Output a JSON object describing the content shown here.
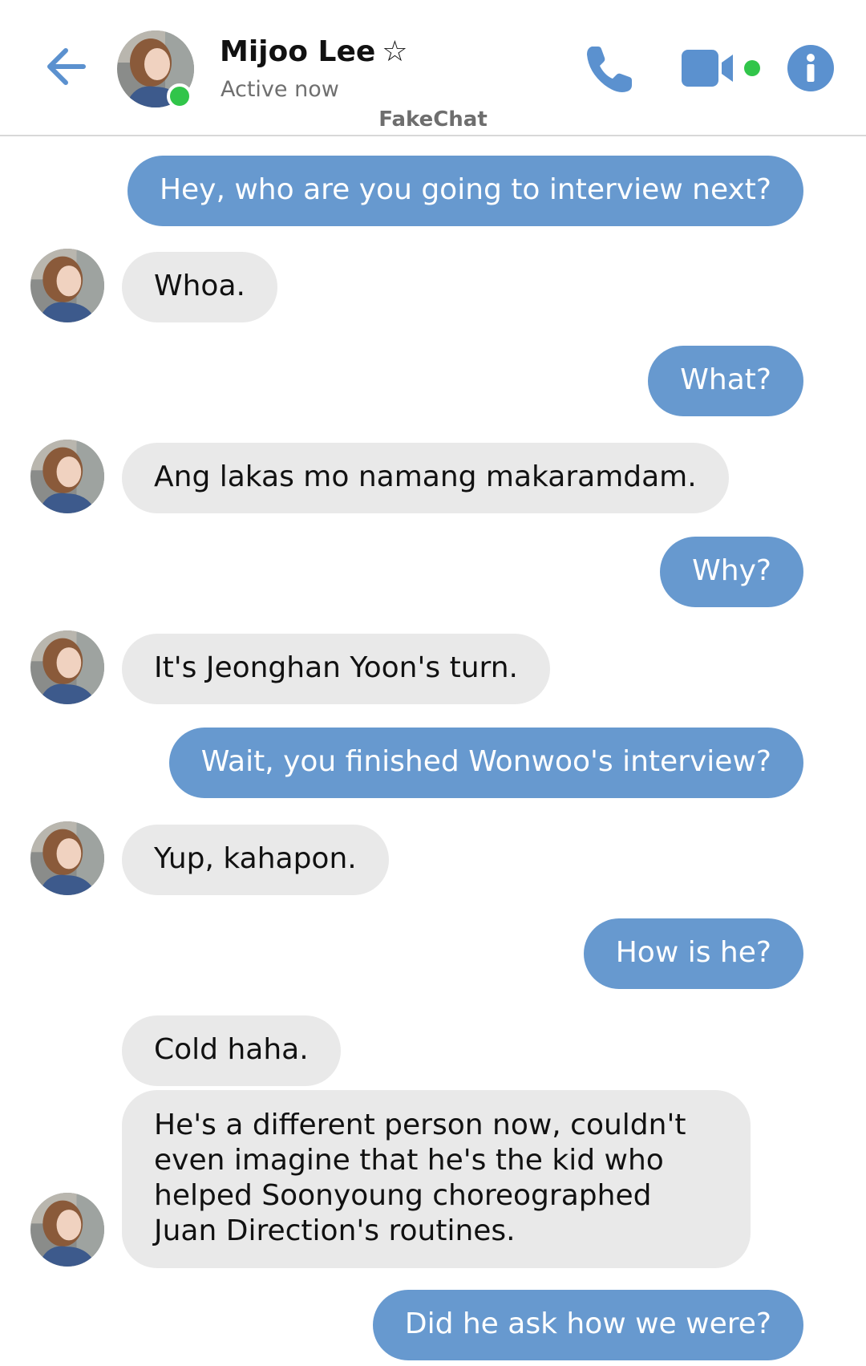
{
  "header": {
    "back_icon": "arrow-left-icon",
    "contact_name": "Mijoo Lee",
    "star": "☆",
    "status": "Active now",
    "app_name": "FakeChat",
    "call_icon": "phone-icon",
    "video_icon": "video-camera-icon",
    "info_icon": "info-icon"
  },
  "colors": {
    "accent": "#5b91cf",
    "outgoing_bubble": "#6799cf",
    "incoming_bubble": "#e9e9e9",
    "online": "#31c54a"
  },
  "messages": [
    {
      "dir": "out",
      "text": "Hey, who are you going to interview next?"
    },
    {
      "dir": "in",
      "text": "Whoa."
    },
    {
      "dir": "out",
      "text": "What?"
    },
    {
      "dir": "in",
      "text": "Ang lakas mo namang makaramdam."
    },
    {
      "dir": "out",
      "text": "Why?"
    },
    {
      "dir": "in",
      "text": "It's Jeonghan Yoon's turn."
    },
    {
      "dir": "out",
      "text": "Wait, you finished Wonwoo's interview?"
    },
    {
      "dir": "in",
      "text": "Yup, kahapon."
    },
    {
      "dir": "out",
      "text": "How is he?"
    },
    {
      "dir": "in",
      "text": "Cold haha."
    },
    {
      "dir": "in",
      "text": "He's a different person now, couldn't even imagine that he's the kid who helped Soonyoung choreographed Juan Direction's routines."
    },
    {
      "dir": "out",
      "text": "Did he ask how we were?"
    }
  ]
}
